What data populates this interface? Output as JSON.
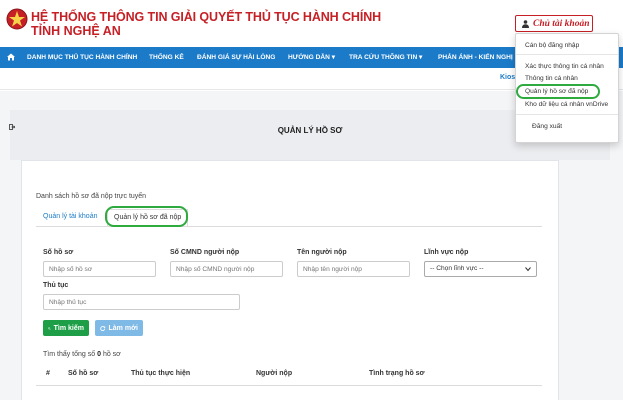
{
  "header": {
    "title_line1": "HỆ THỐNG THÔNG TIN GIẢI QUYẾT THỦ TỤC HÀNH CHÍNH",
    "title_line2": "TỈNH NGHỆ AN",
    "account_label": "Chủ tài khoản",
    "brand_color": "#c62026"
  },
  "nav": {
    "items": [
      "DANH MỤC THỦ TỤC HÀNH CHÍNH",
      "THỐNG KÊ",
      "ĐÁNH GIÁ SỰ HÀI LÒNG",
      "HƯỚNG DẪN ▾",
      "TRA CỨU THÔNG TIN ▾",
      "PHẢN ÁNH - KIẾN NGHỊ"
    ],
    "subbar_text": "Kios",
    "bar_color": "#1b7bc8"
  },
  "dropdown": {
    "items": [
      "Cán bộ đăng nhập",
      "Xác thực thông tin cá nhân",
      "Thông tin cá nhân",
      "Quản lý hồ sơ đã nộp",
      "Kho dữ liệu cá nhân vnDrive",
      "Đăng xuất"
    ]
  },
  "main": {
    "page_title": "QUẢN LÝ HỒ SƠ",
    "list_caption": "Danh sách hồ sơ đã nộp trực tuyến",
    "tabs": [
      "Quản lý tài khoản",
      "Quản lý hồ sơ đã nộp"
    ],
    "form": {
      "ho_so_label": "Số hồ sơ",
      "ho_so_placeholder": "Nhập số hồ sơ",
      "cmnd_label": "Số CMND người nộp",
      "cmnd_placeholder": "Nhập số CMND người nộp",
      "ten_label": "Tên người nộp",
      "ten_placeholder": "Nhập tên người nộp",
      "linh_vuc_label": "Lĩnh vực nộp",
      "linh_vuc_value": "-- Chọn lĩnh vực --",
      "thu_tuc_label": "Thủ tục",
      "thu_tuc_placeholder": "Nhập thủ tục",
      "search_button": "Tìm kiếm",
      "reset_button": "Làm mới"
    },
    "found_prefix": "Tìm thấy tổng số",
    "found_count": "0",
    "found_suffix": "hồ sơ",
    "table_headers": [
      "#",
      "Số hồ sơ",
      "Thủ tục thực hiện",
      "Người nộp",
      "Tình trạng hồ sơ"
    ]
  },
  "colors": {
    "highlight_ring": "#2eaa3f",
    "search_button": "#1f9e48",
    "reset_button": "#7fb9e6"
  }
}
